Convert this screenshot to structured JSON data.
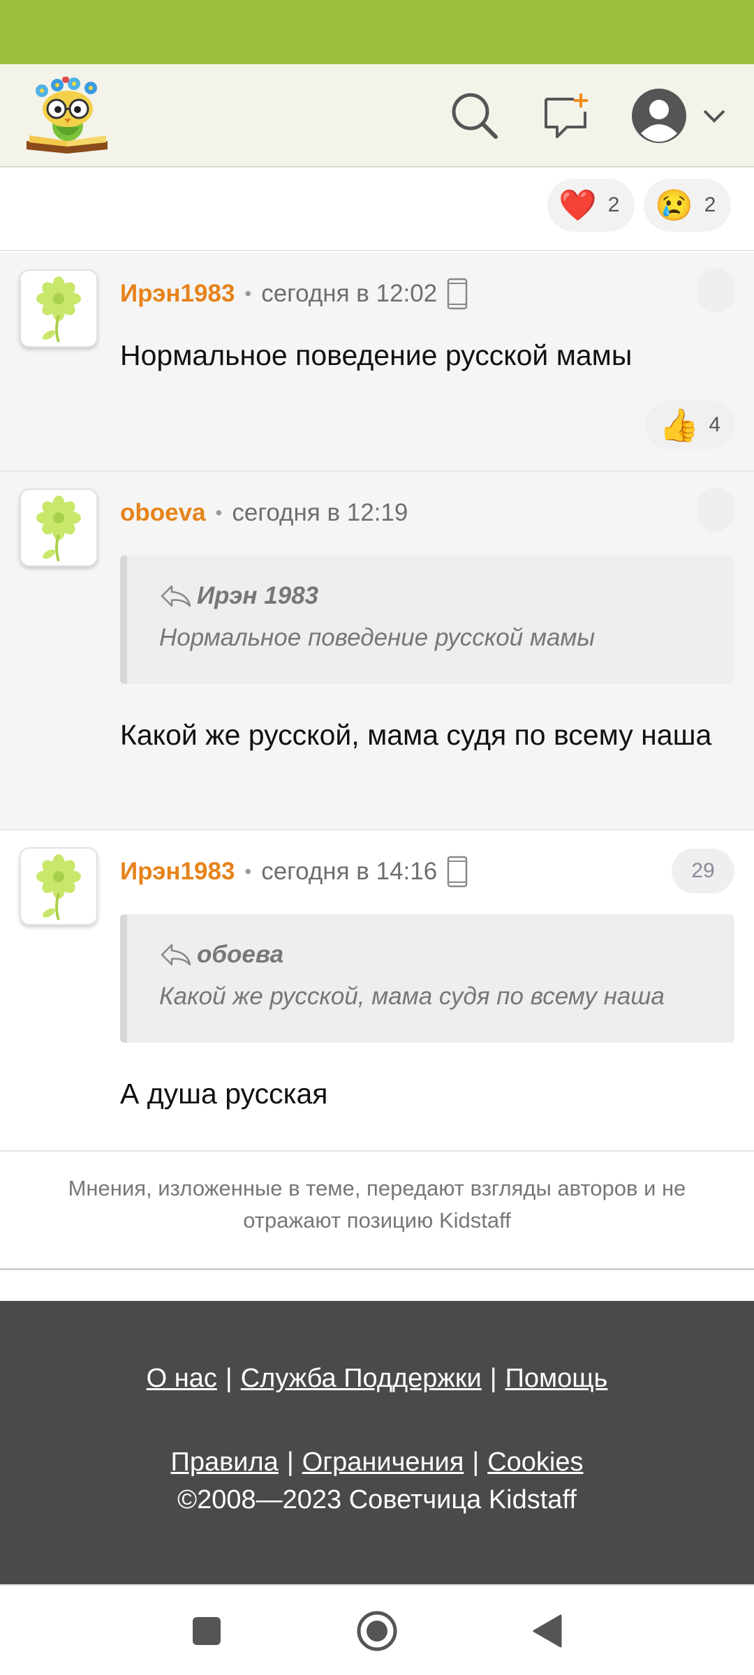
{
  "colors": {
    "status_bar": "#9bc03c",
    "header_bg": "#f3f3ea",
    "author": "#e6831a",
    "footer_bg": "#4a4a4a"
  },
  "header": {
    "logo_icon": "kidstaff-owl-logo-icon",
    "icons": [
      "search-icon",
      "new-message-icon",
      "user-avatar-icon",
      "chevron-down-icon"
    ]
  },
  "reactions": [
    {
      "emoji": "❤️",
      "count": "2"
    },
    {
      "emoji": "😢",
      "count": "2"
    }
  ],
  "comments": [
    {
      "author": "Ирэн1983",
      "time": "сегодня в 12:02",
      "mobile": true,
      "text": "Нормальное поведение русской мамы",
      "like_emoji": "👍",
      "like_count": "4"
    },
    {
      "author": "oboeva",
      "time": "сегодня в 12:19",
      "quote_author": "Ирэн 1983",
      "quote_text": "Нормальное поведение русской мамы",
      "text": "Какой же русской, мама судя по всему наша"
    },
    {
      "author": "Ирэн1983",
      "time": "сегодня в 14:16",
      "mobile": true,
      "badge": "29",
      "quote_author": "обоева",
      "quote_text": "Какой же русской, мама судя по всему наша",
      "text": "А душа русская"
    }
  ],
  "disclaimer": {
    "line1": "Мнения, изложенные в теме, передают взгляды авторов и не",
    "line2": "отражают позицию Kidstaff"
  },
  "footer": {
    "about": "О нас",
    "support": "Служба Поддержки",
    "help": "Помощь",
    "rules": "Правила",
    "restrictions": "Ограничения",
    "cookies": "Cookies",
    "copyright": "©2008—2023 Советчица Kidstaff",
    "separator": "|"
  },
  "navbar": {
    "icons": [
      "recents-square-icon",
      "home-circle-icon",
      "back-triangle-icon"
    ]
  }
}
